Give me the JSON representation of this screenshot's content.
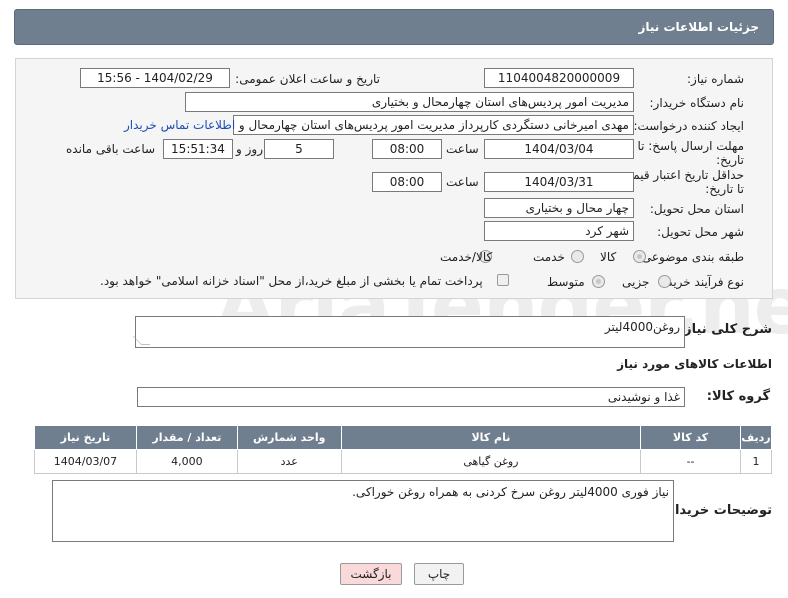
{
  "header": {
    "title": "جزئیات اطلاعات نیاز"
  },
  "form": {
    "need_number_label": "شماره نیاز:",
    "need_number": "1104004820000009",
    "announce_label": "تاریخ و ساعت اعلان عمومی:",
    "announce_value": "1404/02/29 - 15:56",
    "buyer_org_label": "نام دستگاه خریدار:",
    "buyer_org": "مدیریت امور پردیس‌های استان چهارمحال و بختیاری",
    "requester_label": "ایجاد کننده درخواست:",
    "requester": "مهدی امیرخانی دستگردی کارپرداز مدیریت امور پردیس‌های استان چهارمحال و بختیاری",
    "buyer_contact_link": "اطلاعات تماس خریدار",
    "reply_deadline_label": "مهلت ارسال پاسخ: تا تاریخ:",
    "reply_date": "1404/03/04",
    "time_label": "ساعت",
    "reply_time": "08:00",
    "days_value": "5",
    "days_label": "روز و",
    "remaining_time": "15:51:34",
    "remaining_label": "ساعت باقی مانده",
    "price_validity_label": "حداقل تاریخ اعتبار قیمت: تا تاریخ:",
    "price_date": "1404/03/31",
    "price_time": "08:00",
    "delivery_province_label": "استان محل تحویل:",
    "delivery_province": "چهار محال و بختیاری",
    "delivery_city_label": "شهر محل تحویل:",
    "delivery_city": "شهر کرد",
    "category_label": "طبقه بندی موضوعی:",
    "category_options": [
      "کالا",
      "خدمت",
      "کالا/خدمت"
    ],
    "purchase_type_label": "نوع فرآیند خرید :",
    "purchase_options": [
      "جزیی",
      "متوسط"
    ],
    "payment_note": "پرداخت تمام یا بخشی از مبلغ خرید،از محل \"اسناد خزانه اسلامی\" خواهد بود."
  },
  "description": {
    "label": "شرح کلی نیاز:",
    "value": "روغن4000لیتر"
  },
  "goods": {
    "section_title": "اطلاعات کالاهای مورد نیاز",
    "group_label": "گروه کالا:",
    "group_value": "غذا و نوشیدنی",
    "columns": [
      "ردیف",
      "کد کالا",
      "نام کالا",
      "واحد شمارش",
      "تعداد / مقدار",
      "تاریخ نیاز"
    ],
    "rows": [
      {
        "row": "1",
        "code": "--",
        "name": "روغن گیاهی",
        "unit": "عدد",
        "qty": "4,000",
        "date": "1404/03/07"
      }
    ]
  },
  "buyer_notes": {
    "label": "توضیحات خریدار:",
    "value": "نیاز فوری 4000لیتر روغن سرخ کردنی به همراه روغن خوراکی."
  },
  "buttons": {
    "print": "چاپ",
    "back": "بازگشت"
  },
  "watermark": "AriaTender.net",
  "colors": {
    "header": "#6f7f8f",
    "link": "#1a4fb5",
    "back_button": "#f9d9d9"
  }
}
